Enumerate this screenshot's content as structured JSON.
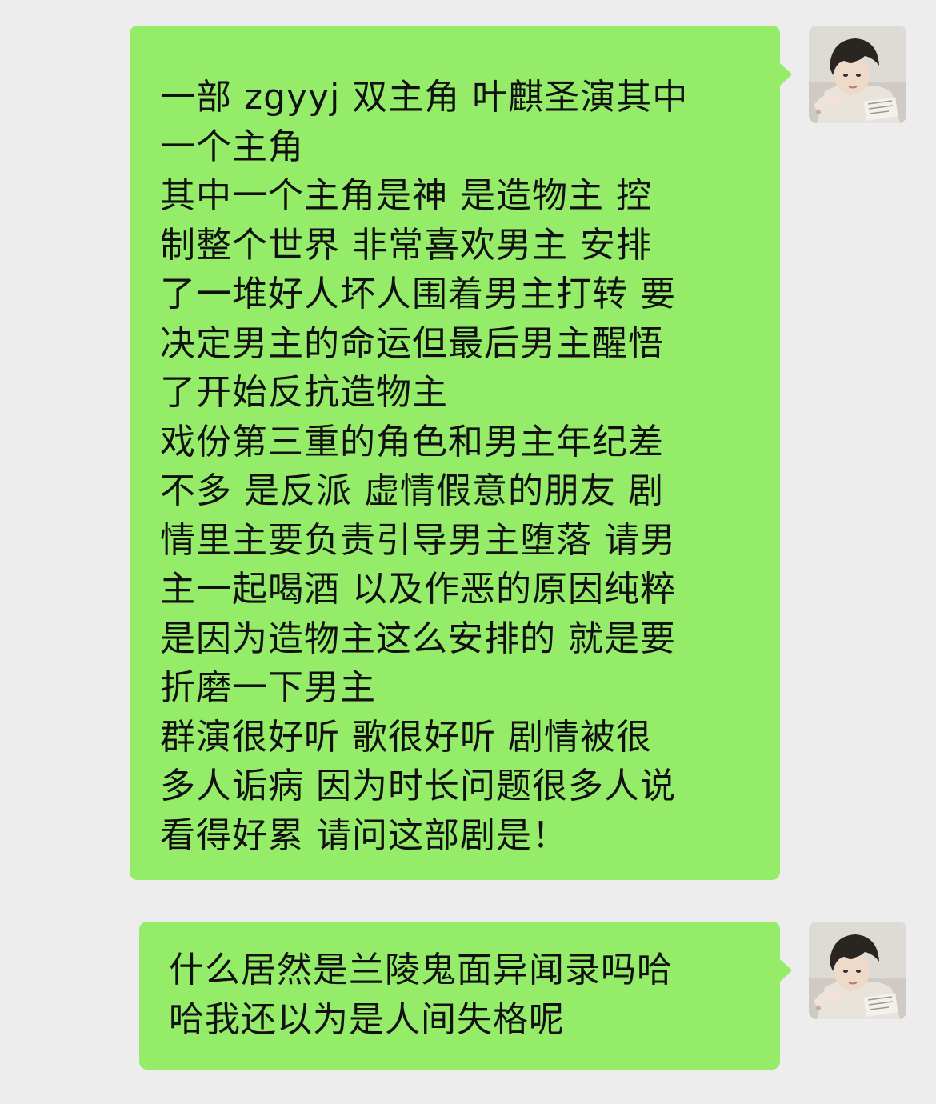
{
  "messages": [
    {
      "sender": "me",
      "avatar_icon": "user-avatar-photo",
      "lines": [
        "一部 zgyyj 双主角 叶麒圣演其中",
        "一个主角",
        "其中一个主角是神 是造物主 控",
        "制整个世界 非常喜欢男主 安排",
        "了一堆好人坏人围着男主打转 要",
        "决定男主的命运但最后男主醒悟",
        "了开始反抗造物主",
        "戏份第三重的角色和男主年纪差",
        "不多 是反派 虚情假意的朋友 剧",
        "情里主要负责引导男主堕落 请男",
        "主一起喝酒 以及作恶的原因纯粹",
        "是因为造物主这么安排的 就是要",
        "折磨一下男主",
        "群演很好听 歌很好听 剧情被很",
        "多人诟病 因为时长问题很多人说",
        "看得好累 请问这部剧是！"
      ]
    },
    {
      "sender": "me",
      "avatar_icon": "user-avatar-photo",
      "lines": [
        "什么居然是兰陵鬼面异闻录吗哈",
        "哈我还以为是人间失格呢"
      ]
    }
  ],
  "colors": {
    "background": "#ededed",
    "bubble": "#95ec69",
    "text": "#111111"
  }
}
